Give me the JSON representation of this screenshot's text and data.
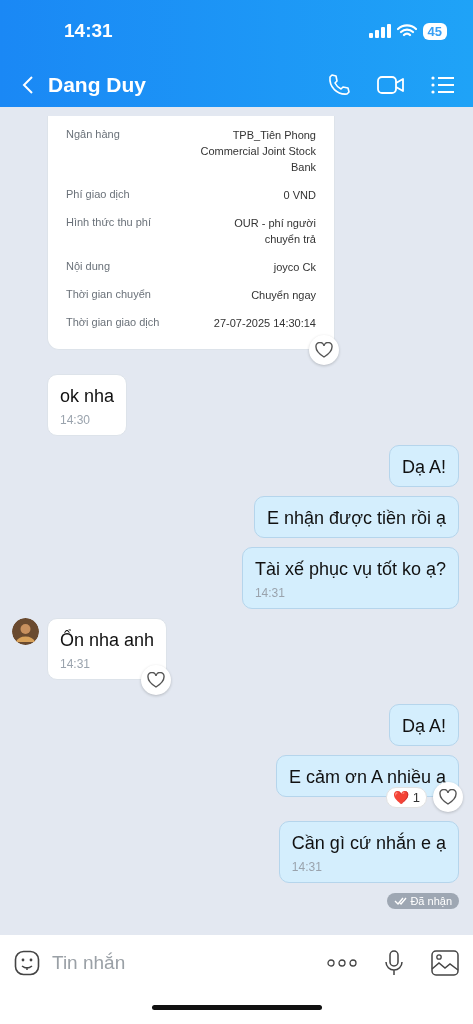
{
  "status_bar": {
    "time": "14:31",
    "battery": "45"
  },
  "header": {
    "title": "Dang Duy"
  },
  "messages": [
    {
      "kind": "receipt",
      "outgoing": false,
      "show_avatar": false,
      "liked": true,
      "rows": [
        {
          "label": "Ngân hàng",
          "value": "TPB_Tiên Phong Commercial Joint Stock Bank"
        },
        {
          "label": "Phí giao dịch",
          "value": "0 VND"
        },
        {
          "label": "Hình thức thu phí",
          "value": "OUR - phí người chuyển trả"
        },
        {
          "label": "Nội dung",
          "value": "joyco Ck"
        },
        {
          "label": "Thời gian chuyển",
          "value": "Chuyển ngay"
        },
        {
          "label": "Thời gian giao dịch",
          "value": "27-07-2025 14:30:14"
        }
      ]
    },
    {
      "kind": "text",
      "outgoing": false,
      "show_avatar": false,
      "liked": false,
      "text": "ok nha",
      "time": "14:30"
    },
    {
      "kind": "text",
      "outgoing": true,
      "show_avatar": false,
      "liked": false,
      "text": "Dạ A!"
    },
    {
      "kind": "text",
      "outgoing": true,
      "show_avatar": false,
      "liked": false,
      "text": "E nhận được tiền rồi ạ"
    },
    {
      "kind": "text",
      "outgoing": true,
      "show_avatar": false,
      "liked": false,
      "text": "Tài xế phục vụ tốt ko ạ?",
      "time": "14:31"
    },
    {
      "kind": "text",
      "outgoing": false,
      "show_avatar": true,
      "liked": true,
      "text": "Ổn nha anh",
      "time": "14:31"
    },
    {
      "kind": "text",
      "outgoing": true,
      "show_avatar": false,
      "liked": false,
      "text": "Dạ A!"
    },
    {
      "kind": "text",
      "outgoing": true,
      "show_avatar": false,
      "liked": true,
      "text": "E cảm ơn A nhiều ạ",
      "reaction": {
        "emoji": "❤️",
        "count": "1"
      }
    },
    {
      "kind": "text",
      "outgoing": true,
      "show_avatar": false,
      "liked": false,
      "text": "Cần gì cứ nhắn e ạ",
      "time": "14:31"
    }
  ],
  "delivery_status": "Đã nhận",
  "composer": {
    "placeholder": "Tin nhắn"
  }
}
